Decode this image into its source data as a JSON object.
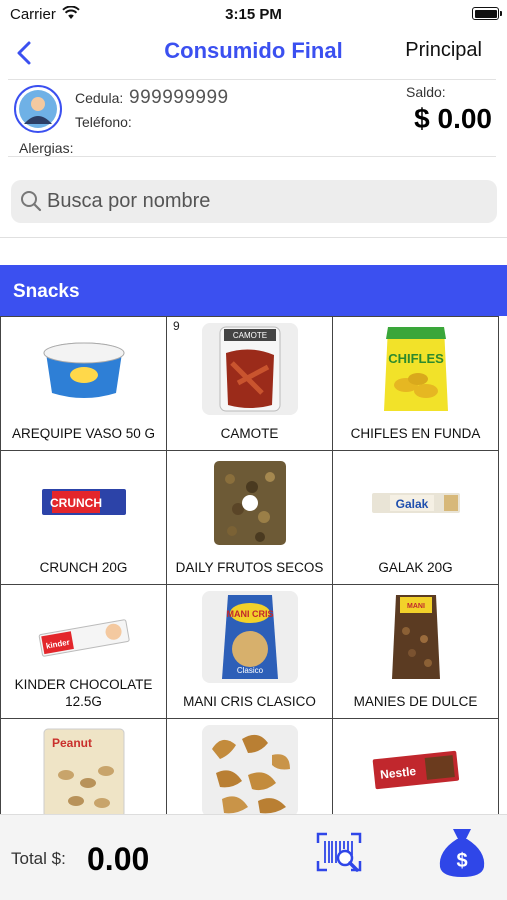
{
  "status_bar": {
    "carrier": "Carrier",
    "time": "3:15 PM"
  },
  "nav": {
    "title": "Consumido Final",
    "right_label": "Principal"
  },
  "customer": {
    "cedula_label": "Cedula:",
    "cedula_value": "999999999",
    "telefono_label": "Teléfono:",
    "alergias_label": "Alergias:",
    "saldo_label": "Saldo:",
    "saldo_value": "$ 0.00"
  },
  "search": {
    "placeholder": "Busca por nombre"
  },
  "category": {
    "title": "Snacks"
  },
  "products": [
    {
      "name": "AREQUIPE VASO 50 G",
      "icon": "arequipe-cup-icon",
      "badge": ""
    },
    {
      "name": "CAMOTE",
      "icon": "camote-bag-icon",
      "badge": "9"
    },
    {
      "name": "CHIFLES EN FUNDA",
      "icon": "chifles-bag-icon",
      "badge": ""
    },
    {
      "name": "CRUNCH 20G",
      "icon": "crunch-bar-icon",
      "badge": ""
    },
    {
      "name": "DAILY FRUTOS SECOS",
      "icon": "nuts-bag-icon",
      "badge": ""
    },
    {
      "name": "GALAK 20G",
      "icon": "galak-bar-icon",
      "badge": ""
    },
    {
      "name": "KINDER CHOCOLATE 12.5G",
      "icon": "kinder-bar-icon",
      "badge": ""
    },
    {
      "name": "MANI CRIS CLASICO",
      "icon": "mani-cris-bag-icon",
      "badge": ""
    },
    {
      "name": "MANIES DE DULCE",
      "icon": "manies-dulce-bag-icon",
      "badge": ""
    },
    {
      "name": "",
      "icon": "peanut-bag-icon",
      "badge": ""
    },
    {
      "name": "",
      "icon": "cashews-icon",
      "badge": ""
    },
    {
      "name": "",
      "icon": "nestle-chocolate-icon",
      "badge": ""
    }
  ],
  "footer": {
    "total_label": "Total $:",
    "total_value": "0.00"
  },
  "colors": {
    "accent": "#3b50f0",
    "header_bg": "#3b50f0",
    "pay_icon": "#2f46e8"
  }
}
